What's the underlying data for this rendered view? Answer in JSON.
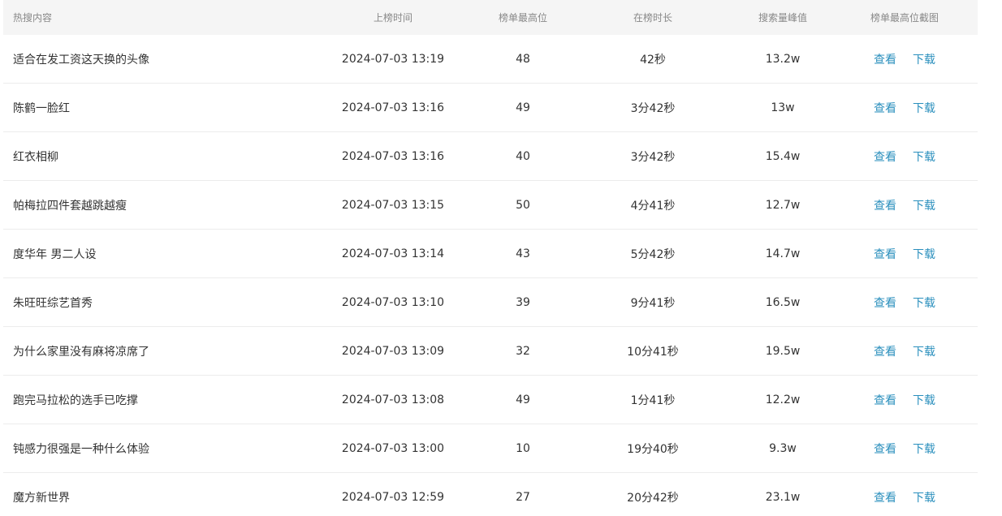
{
  "table": {
    "headers": {
      "title": "热搜内容",
      "time": "上榜时间",
      "rank": "榜单最高位",
      "duration": "在榜时长",
      "peak": "搜索量峰值",
      "screenshot": "榜单最高位截图"
    },
    "action_view": "查看",
    "action_download": "下载",
    "rows": [
      {
        "title": "适合在发工资这天换的头像",
        "time": "2024-07-03 13:19",
        "rank": "48",
        "duration": "42秒",
        "peak": "13.2w"
      },
      {
        "title": "陈鹤一脸红",
        "time": "2024-07-03 13:16",
        "rank": "49",
        "duration": "3分42秒",
        "peak": "13w"
      },
      {
        "title": "红衣相柳",
        "time": "2024-07-03 13:16",
        "rank": "40",
        "duration": "3分42秒",
        "peak": "15.4w"
      },
      {
        "title": "帕梅拉四件套越跳越瘦",
        "time": "2024-07-03 13:15",
        "rank": "50",
        "duration": "4分41秒",
        "peak": "12.7w"
      },
      {
        "title": "度华年 男二人设",
        "time": "2024-07-03 13:14",
        "rank": "43",
        "duration": "5分42秒",
        "peak": "14.7w"
      },
      {
        "title": "朱旺旺综艺首秀",
        "time": "2024-07-03 13:10",
        "rank": "39",
        "duration": "9分41秒",
        "peak": "16.5w"
      },
      {
        "title": "为什么家里没有麻将凉席了",
        "time": "2024-07-03 13:09",
        "rank": "32",
        "duration": "10分41秒",
        "peak": "19.5w"
      },
      {
        "title": "跑完马拉松的选手已吃撑",
        "time": "2024-07-03 13:08",
        "rank": "49",
        "duration": "1分41秒",
        "peak": "12.2w"
      },
      {
        "title": "钝感力很强是一种什么体验",
        "time": "2024-07-03 13:00",
        "rank": "10",
        "duration": "19分40秒",
        "peak": "9.3w"
      },
      {
        "title": "魔方新世界",
        "time": "2024-07-03 12:59",
        "rank": "27",
        "duration": "20分42秒",
        "peak": "23.1w"
      }
    ]
  },
  "colors": {
    "link": "#2a8fbd",
    "header_bg": "#f5f5f5",
    "header_text": "#888888",
    "body_text": "#333333",
    "row_border": "#ececec"
  }
}
